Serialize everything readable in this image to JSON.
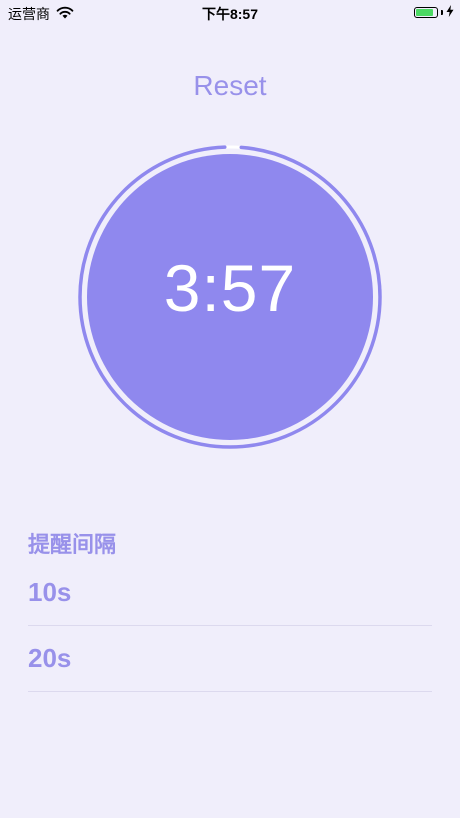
{
  "status_bar": {
    "carrier": "运营商",
    "time": "下午8:57",
    "battery_color": "#4cd964"
  },
  "reset": {
    "label": "Reset"
  },
  "timer": {
    "display": "3:57",
    "progress": 0.988,
    "fill_color": "#8f88ee",
    "ring_color": "#8f88ee"
  },
  "interval": {
    "title": "提醒间隔",
    "options": [
      {
        "label": "10s"
      },
      {
        "label": "20s"
      }
    ]
  },
  "colors": {
    "accent": "#9891ea",
    "background": "#f0eefb"
  }
}
